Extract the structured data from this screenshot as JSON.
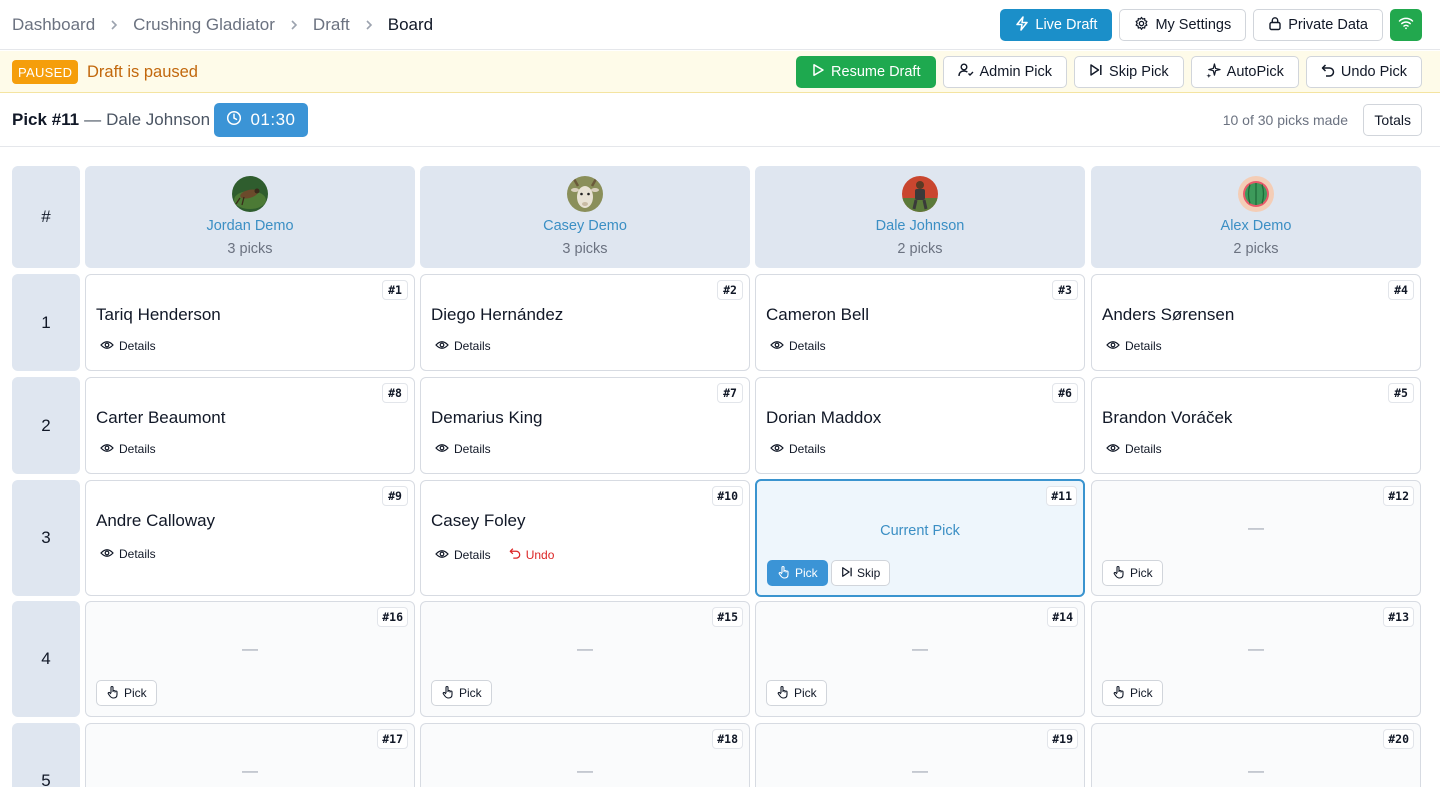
{
  "breadcrumb": [
    "Dashboard",
    "Crushing Gladiator",
    "Draft",
    "Board"
  ],
  "top_actions": {
    "live_draft": "Live Draft",
    "my_settings": "My Settings",
    "private_data": "Private Data"
  },
  "status": {
    "badge": "PAUSED",
    "message": "Draft is paused"
  },
  "admin_actions": {
    "resume": "Resume Draft",
    "admin_pick": "Admin Pick",
    "skip_pick": "Skip Pick",
    "autopick": "AutoPick",
    "undo_pick": "Undo Pick"
  },
  "pick_bar": {
    "pick": "Pick #11",
    "separator": "—",
    "picker": "Dale Johnson",
    "timer": "01:30",
    "progress": "10 of 30 picks made",
    "totals": "Totals"
  },
  "board": {
    "round_header": "#",
    "teams": [
      {
        "name": "Jordan Demo",
        "picks": "3 picks",
        "avatar_icon": "grasshopper-avatar"
      },
      {
        "name": "Casey Demo",
        "picks": "3 picks",
        "avatar_icon": "goat-avatar"
      },
      {
        "name": "Dale Johnson",
        "picks": "2 picks",
        "avatar_icon": "runner-avatar"
      },
      {
        "name": "Alex Demo",
        "picks": "2 picks",
        "avatar_icon": "melon-avatar"
      }
    ],
    "rounds": [
      {
        "label": "1",
        "cells": [
          {
            "no": "#1",
            "player": "Tariq Henderson",
            "details": "Details"
          },
          {
            "no": "#2",
            "player": "Diego Hernández",
            "details": "Details"
          },
          {
            "no": "#3",
            "player": "Cameron Bell",
            "details": "Details"
          },
          {
            "no": "#4",
            "player": "Anders Sørensen",
            "details": "Details"
          }
        ]
      },
      {
        "label": "2",
        "cells": [
          {
            "no": "#8",
            "player": "Carter Beaumont",
            "details": "Details"
          },
          {
            "no": "#7",
            "player": "Demarius King",
            "details": "Details"
          },
          {
            "no": "#6",
            "player": "Dorian Maddox",
            "details": "Details"
          },
          {
            "no": "#5",
            "player": "Brandon Voráček",
            "details": "Details"
          }
        ]
      },
      {
        "label": "3",
        "cells": [
          {
            "no": "#9",
            "player": "Andre Calloway",
            "details": "Details"
          },
          {
            "no": "#10",
            "player": "Casey Foley",
            "details": "Details",
            "undo": "Undo"
          },
          {
            "no": "#11",
            "current": "Current Pick",
            "pick": "Pick",
            "skip": "Skip"
          },
          {
            "no": "#12",
            "empty": "—",
            "pick": "Pick"
          }
        ]
      },
      {
        "label": "4",
        "cells": [
          {
            "no": "#16",
            "empty": "—",
            "pick": "Pick"
          },
          {
            "no": "#15",
            "empty": "—",
            "pick": "Pick"
          },
          {
            "no": "#14",
            "empty": "—",
            "pick": "Pick"
          },
          {
            "no": "#13",
            "empty": "—",
            "pick": "Pick"
          }
        ]
      },
      {
        "label": "5",
        "cells": [
          {
            "no": "#17",
            "empty": "—"
          },
          {
            "no": "#18",
            "empty": "—"
          },
          {
            "no": "#19",
            "empty": "—"
          },
          {
            "no": "#20",
            "empty": "—"
          }
        ]
      }
    ]
  },
  "colors": {
    "primary_blue": "#1b8fc9",
    "resume_green": "#1ea94f",
    "paused_amber": "#f59e0b",
    "team_name_blue": "#3b8fc4",
    "undo_red": "#dc2626"
  }
}
